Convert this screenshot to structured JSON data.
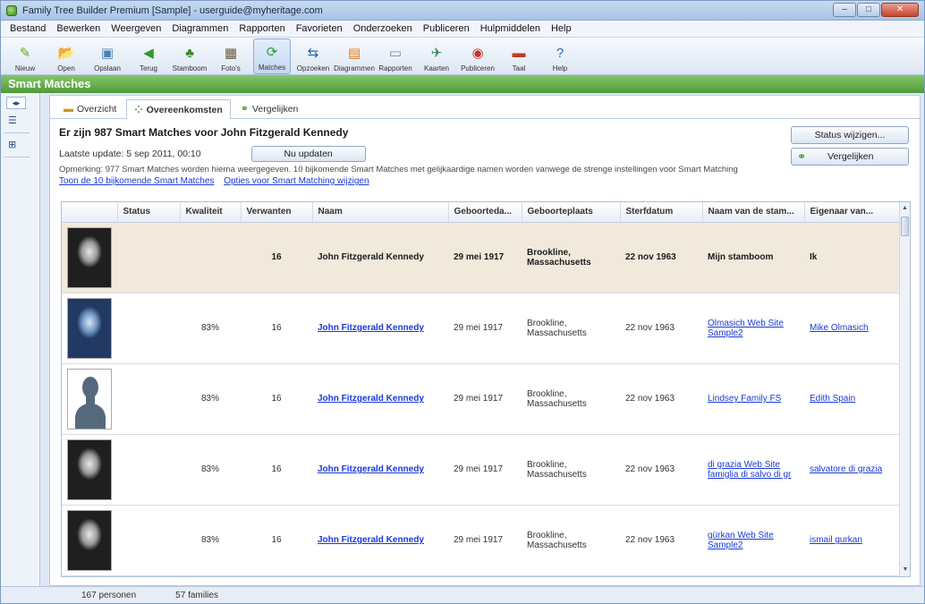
{
  "window": {
    "title": "Family Tree Builder Premium [Sample] - userguide@myheritage.com",
    "controls": {
      "minimize": "–",
      "maximize": "□",
      "close": "✕"
    }
  },
  "menu": [
    "Bestand",
    "Bewerken",
    "Weergeven",
    "Diagrammen",
    "Rapporten",
    "Favorieten",
    "Onderzoeken",
    "Publiceren",
    "Hulpmiddelen",
    "Help"
  ],
  "toolbar": [
    {
      "label": "Nieuw",
      "icon": "new-icon",
      "glyph": "✎",
      "color": "#6aa82e",
      "active": false
    },
    {
      "label": "Open",
      "icon": "open-icon",
      "glyph": "📂",
      "color": "#d9a52a",
      "active": false
    },
    {
      "label": "Opslaan",
      "icon": "save-icon",
      "glyph": "▣",
      "color": "#4d7fb3",
      "active": false
    },
    {
      "label": "Terug",
      "icon": "back-icon",
      "glyph": "◀",
      "color": "#2e9a2e",
      "active": false
    },
    {
      "label": "Stamboom",
      "icon": "family-tree-icon",
      "glyph": "♣",
      "color": "#3d8a2e",
      "active": false
    },
    {
      "label": "Foto's",
      "icon": "photos-icon",
      "glyph": "▦",
      "color": "#6a5a3e",
      "active": false
    },
    {
      "label": "Matches",
      "icon": "matches-icon",
      "glyph": "⟳",
      "color": "#2e9a3e",
      "active": true
    },
    {
      "label": "Opzoeken",
      "icon": "lookup-icon",
      "glyph": "⇆",
      "color": "#2d62b8",
      "active": false
    },
    {
      "label": "Diagrammen",
      "icon": "charts-icon",
      "glyph": "▤",
      "color": "#e07b1e",
      "active": false
    },
    {
      "label": "Rapporten",
      "icon": "reports-icon",
      "glyph": "▭",
      "color": "#7a8aa0",
      "active": false
    },
    {
      "label": "Kaarten",
      "icon": "maps-icon",
      "glyph": "✈",
      "color": "#3a8a5a",
      "active": false
    },
    {
      "label": "Publiceren",
      "icon": "publish-icon",
      "glyph": "◉",
      "color": "#c0392b",
      "active": false
    },
    {
      "label": "Taal",
      "icon": "language-flag-icon",
      "glyph": "▬",
      "color": "#c0392b",
      "active": false
    },
    {
      "label": "Help",
      "icon": "help-icon",
      "glyph": "?",
      "color": "#2d62b8",
      "active": false
    }
  ],
  "banner": {
    "title": "Smart Matches"
  },
  "tabs": [
    {
      "label": "Overzicht",
      "icon": "folder-icon",
      "glyph": "▬",
      "active": false
    },
    {
      "label": "Overeenkomsten",
      "icon": "matches-grid-icon",
      "glyph": "⁘",
      "active": true
    },
    {
      "label": "Vergelijken",
      "icon": "compare-icon",
      "glyph": "⚭",
      "active": false
    }
  ],
  "summary": {
    "heading": "Er zijn 987 Smart Matches voor John Fitzgerald Kennedy",
    "last_update": "Laatste update: 5 sep 2011, 00:10",
    "update_button": "Nu updaten",
    "note": "Opmerking: 977 Smart Matches worden hierna weergegeven. 10 bijkomende Smart Matches met gelijkaardige namen worden vanwege de strenge instellingen voor Smart Matching",
    "link_show_more": "Toon de 10 bijkomende Smart Matches",
    "link_options": "Opties voor Smart Matching wijzigen",
    "status_button": "Status wijzigen...",
    "compare_button": "Vergelijken"
  },
  "table": {
    "columns": [
      "",
      "Status",
      "Kwaliteit",
      "Verwanten",
      "Naam",
      "Geboorteda...",
      "Geboorteplaats",
      "Sterfdatum",
      "Naam van de stam...",
      "Eigenaar van..."
    ],
    "rows": [
      {
        "photo": "bw",
        "status": "",
        "quality": "",
        "relatives": "16",
        "name": "John Fitzgerald Kennedy",
        "birth_date": "29 mei 1917",
        "birth_place": "Brookline, Massachusetts",
        "death_date": "22 nov 1963",
        "tree_name": "Mijn stamboom",
        "owner": "Ik",
        "highlight": true
      },
      {
        "photo": "blue",
        "status": "",
        "quality": "83%",
        "relatives": "16",
        "name": "John Fitzgerald Kennedy",
        "birth_date": "29 mei 1917",
        "birth_place": "Brookline, Massachusetts",
        "death_date": "22 nov 1963",
        "tree_name": "Olmasich Web Site Sample2",
        "owner": "Mike Olmasich",
        "highlight": false
      },
      {
        "photo": "silhouette",
        "status": "",
        "quality": "83%",
        "relatives": "16",
        "name": "John Fitzgerald Kennedy",
        "birth_date": "29 mei 1917",
        "birth_place": "Brookline, Massachusetts",
        "death_date": "22 nov 1963",
        "tree_name": "Lindsey Family FS",
        "owner": "Edith Spain",
        "highlight": false
      },
      {
        "photo": "bw",
        "status": "",
        "quality": "83%",
        "relatives": "16",
        "name": "John Fitzgerald Kennedy",
        "birth_date": "29 mei 1917",
        "birth_place": "Brookline, Massachusetts",
        "death_date": "22 nov 1963",
        "tree_name": "di grazia Web Site famiglia di salvo di gr",
        "owner": "salvatore di grazia",
        "highlight": false
      },
      {
        "photo": "bw",
        "status": "",
        "quality": "83%",
        "relatives": "16",
        "name": "John Fitzgerald Kennedy",
        "birth_date": "29 mei 1917",
        "birth_place": "Brookline, Massachusetts",
        "death_date": "22 nov 1963",
        "tree_name": "gürkan Web Site Sample2",
        "owner": "ismail gurkan",
        "highlight": false
      }
    ]
  },
  "statusbar": {
    "persons": "167 personen",
    "families": "57 families"
  }
}
